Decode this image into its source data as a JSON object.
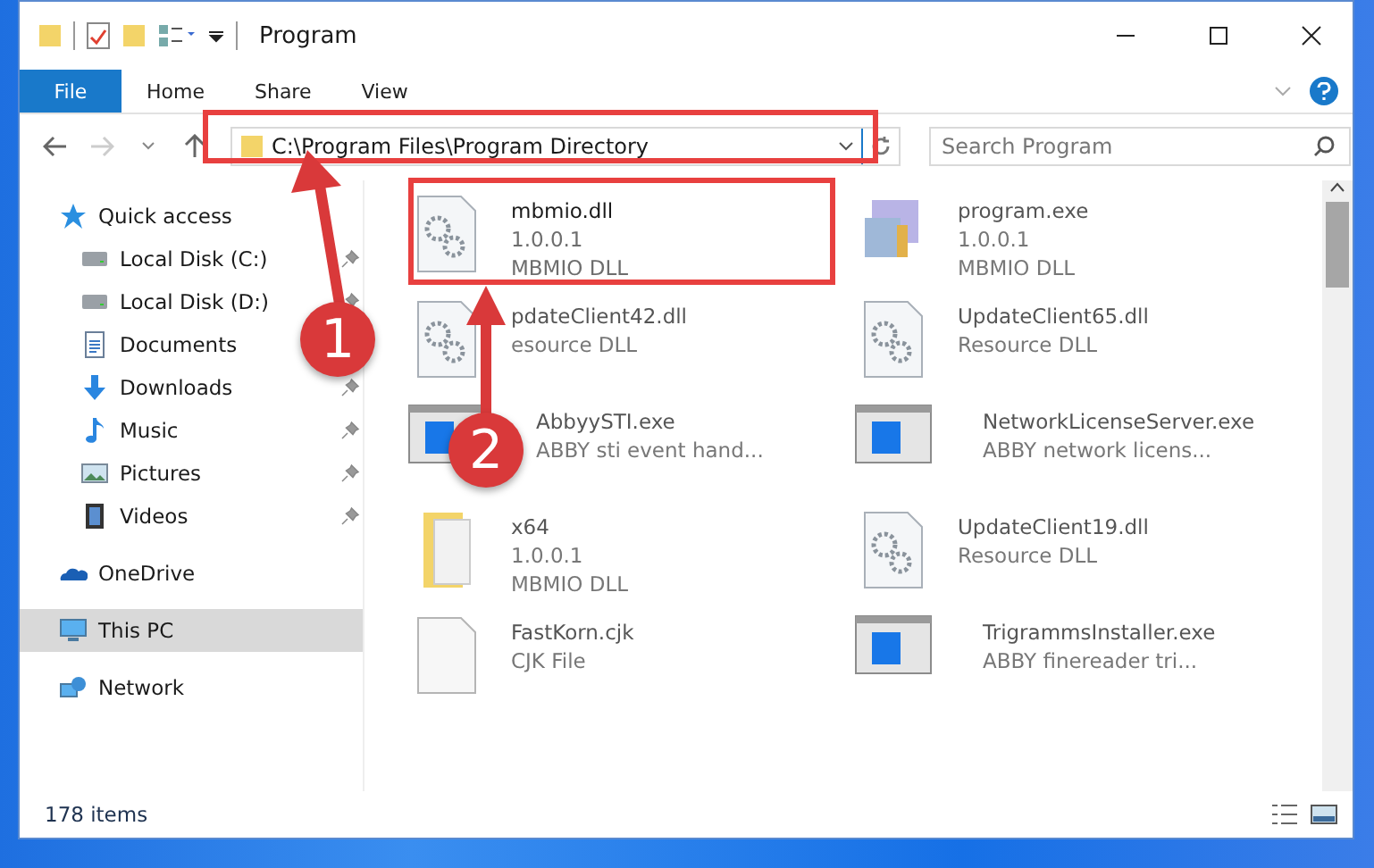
{
  "window": {
    "title": "Program"
  },
  "ribbon": {
    "tabs": [
      {
        "label": "File",
        "kind": "file"
      },
      {
        "label": "Home",
        "kind": "tab"
      },
      {
        "label": "Share",
        "kind": "tab"
      },
      {
        "label": "View",
        "kind": "tab"
      }
    ]
  },
  "address_bar": {
    "value": "C:\\Program Files\\Program Directory"
  },
  "search": {
    "placeholder": "Search Program"
  },
  "sidebar": {
    "items": [
      {
        "label": "Quick access",
        "kind": "star",
        "selected": false,
        "children": [
          {
            "label": "Local Disk (C:)",
            "kind": "drive",
            "pinned": true,
            "selected": false
          },
          {
            "label": "Local Disk (D:)",
            "kind": "drive",
            "pinned": true,
            "selected": false
          },
          {
            "label": "Documents",
            "kind": "document",
            "selected": false
          },
          {
            "label": "Downloads",
            "kind": "download",
            "pinned": true,
            "selected": false
          },
          {
            "label": "Music",
            "kind": "music",
            "pinned": true,
            "selected": false
          },
          {
            "label": "Pictures",
            "kind": "pictures",
            "pinned": true,
            "selected": false
          },
          {
            "label": "Videos",
            "kind": "videos",
            "pinned": true,
            "selected": false
          }
        ]
      },
      {
        "label": "OneDrive",
        "kind": "cloud",
        "selected": false
      },
      {
        "label": "This PC",
        "kind": "pc",
        "selected": true
      },
      {
        "label": "Network",
        "kind": "network",
        "selected": false
      }
    ]
  },
  "files": [
    {
      "name": "mbmio.dll",
      "details": [
        "1.0.0.1",
        "MBMIO DLL"
      ],
      "kind": "dll",
      "blurred": false
    },
    {
      "name": "program.exe",
      "details": [
        "1.0.0.1",
        "MBMIO DLL"
      ],
      "kind": "setup",
      "blurred": true
    },
    {
      "name": "pdateClient42.dll",
      "details": [
        "esource DLL"
      ],
      "kind": "dll",
      "blurred": true
    },
    {
      "name": "UpdateClient65.dll",
      "details": [
        "Resource DLL"
      ],
      "kind": "dll",
      "blurred": true
    },
    {
      "name": "AbbyySTI.exe",
      "details": [
        "ABBY sti event hand..."
      ],
      "kind": "app",
      "blurred": true
    },
    {
      "name": "NetworkLicenseServer.exe",
      "details": [
        "ABBY network licens..."
      ],
      "kind": "app",
      "blurred": true
    },
    {
      "name": "x64",
      "details": [
        "1.0.0.1",
        "MBMIO DLL"
      ],
      "kind": "folder",
      "blurred": true
    },
    {
      "name": "UpdateClient19.dll",
      "details": [
        "Resource DLL"
      ],
      "kind": "dll",
      "blurred": true
    },
    {
      "name": "FastKorn.cjk",
      "details": [
        "CJK File"
      ],
      "kind": "file",
      "blurred": true
    },
    {
      "name": "TrigrammsInstaller.exe",
      "details": [
        "ABBY finereader tri..."
      ],
      "kind": "app",
      "blurred": true
    }
  ],
  "status_bar": {
    "count": "178 items"
  },
  "annotations": [
    {
      "label": "1"
    },
    {
      "label": "2"
    }
  ]
}
